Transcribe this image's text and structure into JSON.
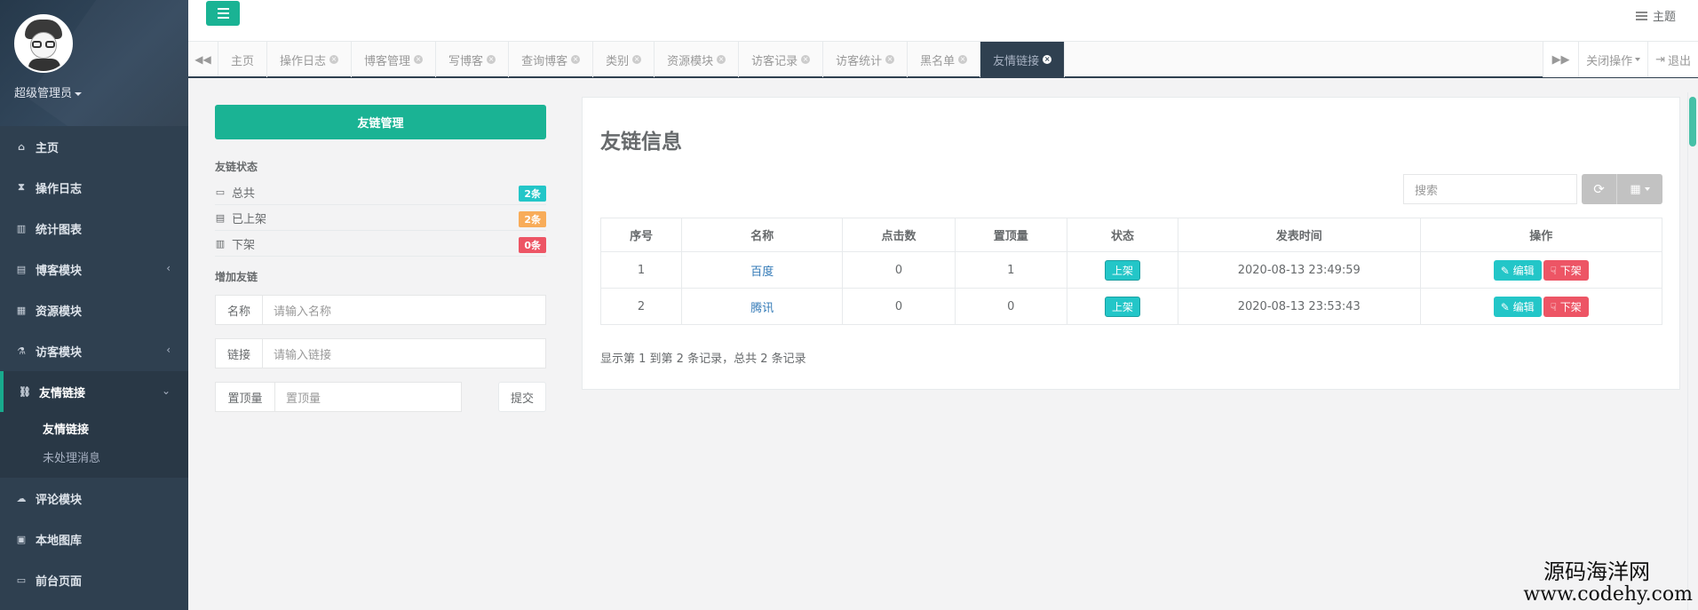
{
  "user": {
    "name": "超级管理员"
  },
  "sidebar": {
    "items": [
      {
        "label": "主页",
        "icon": "home-icon",
        "glyph": "⌂"
      },
      {
        "label": "操作日志",
        "icon": "hourglass-icon",
        "glyph": "⧗"
      },
      {
        "label": "统计图表",
        "icon": "bar-chart-icon",
        "glyph": "▥"
      },
      {
        "label": "博客模块",
        "icon": "book-icon",
        "glyph": "▤",
        "arrow": "‹"
      },
      {
        "label": "资源模块",
        "icon": "grid-icon",
        "glyph": "▦"
      },
      {
        "label": "访客模块",
        "icon": "flask-icon",
        "glyph": "⚗",
        "arrow": "‹"
      },
      {
        "label": "友情链接",
        "icon": "link-icon",
        "glyph": "⛓",
        "arrow": "⌄"
      },
      {
        "label": "评论模块",
        "icon": "comment-icon",
        "glyph": "☁"
      },
      {
        "label": "本地图库",
        "icon": "picture-icon",
        "glyph": "▣"
      },
      {
        "label": "前台页面",
        "icon": "desktop-icon",
        "glyph": "▭"
      }
    ],
    "submenu": [
      "友情链接",
      "未处理消息"
    ]
  },
  "topbar": {
    "theme_label": "主题"
  },
  "tabs": {
    "items": [
      "主页",
      "操作日志",
      "博客管理",
      "写博客",
      "查询博客",
      "类别",
      "资源模块",
      "访客记录",
      "访客统计",
      "黑名单",
      "友情链接"
    ],
    "close_ops": "关闭操作",
    "logout": "退出"
  },
  "left": {
    "manage_button": "友链管理",
    "status_title": "友链状态",
    "stats": [
      {
        "label": "总共",
        "count": "2条",
        "color": "#23c6c8"
      },
      {
        "label": "已上架",
        "count": "2条",
        "color": "#f8ac59"
      },
      {
        "label": "下架",
        "count": "0条",
        "color": "#ed5565"
      }
    ],
    "add_title": "增加友链",
    "form": {
      "name_label": "名称",
      "name_placeholder": "请输入名称",
      "link_label": "链接",
      "link_placeholder": "请输入链接",
      "top_label": "置顶量",
      "top_placeholder": "置顶量",
      "submit": "提交"
    }
  },
  "right": {
    "title": "友链信息",
    "search_placeholder": "搜索",
    "columns": [
      "序号",
      "名称",
      "点击数",
      "置顶量",
      "状态",
      "发表时间",
      "操作"
    ],
    "rows": [
      {
        "idx": "1",
        "name": "百度",
        "clicks": "0",
        "top": "1",
        "status": "上架",
        "time": "2020-08-13 23:49:59"
      },
      {
        "idx": "2",
        "name": "腾讯",
        "clicks": "0",
        "top": "0",
        "status": "上架",
        "time": "2020-08-13 23:53:43"
      }
    ],
    "edit_label": "编辑",
    "down_label": "下架",
    "pager": "显示第 1 到第 2 条记录，总共 2 条记录"
  },
  "watermark": {
    "line1": "源码海洋网",
    "line2": "www.codehy.com"
  }
}
